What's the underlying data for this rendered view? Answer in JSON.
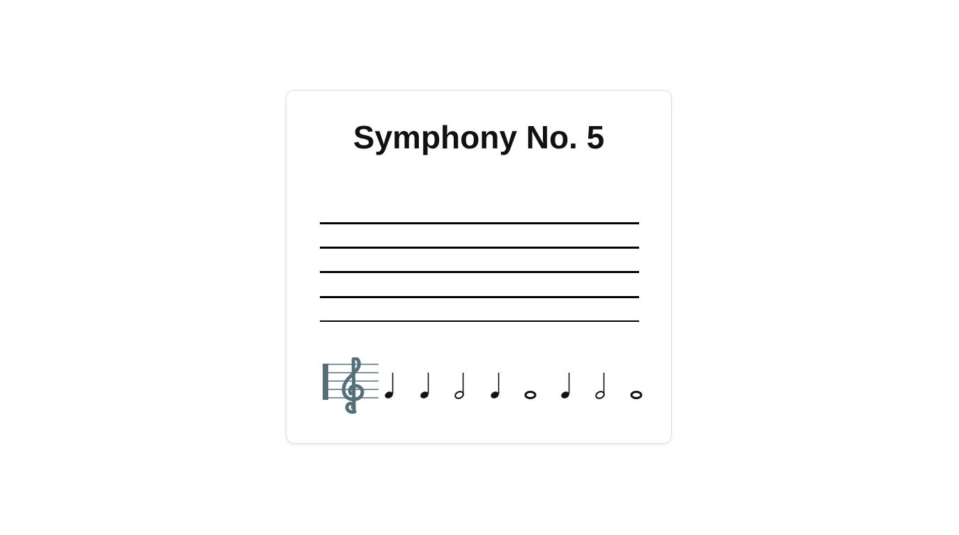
{
  "card": {
    "title": "Symphony No. 5"
  },
  "staff": {
    "line_count": 5,
    "line_color": "#000000"
  },
  "clef": {
    "icon": "treble-clef-icon",
    "color": "#546e7a"
  },
  "notes": [
    {
      "icon": "quarter-note-icon",
      "type": "quarter"
    },
    {
      "icon": "quarter-note-icon",
      "type": "quarter"
    },
    {
      "icon": "half-note-icon",
      "type": "half"
    },
    {
      "icon": "quarter-note-icon",
      "type": "quarter"
    },
    {
      "icon": "whole-note-icon",
      "type": "whole"
    },
    {
      "icon": "quarter-note-icon",
      "type": "quarter"
    },
    {
      "icon": "half-note-icon",
      "type": "half"
    },
    {
      "icon": "whole-note-icon",
      "type": "whole"
    }
  ]
}
